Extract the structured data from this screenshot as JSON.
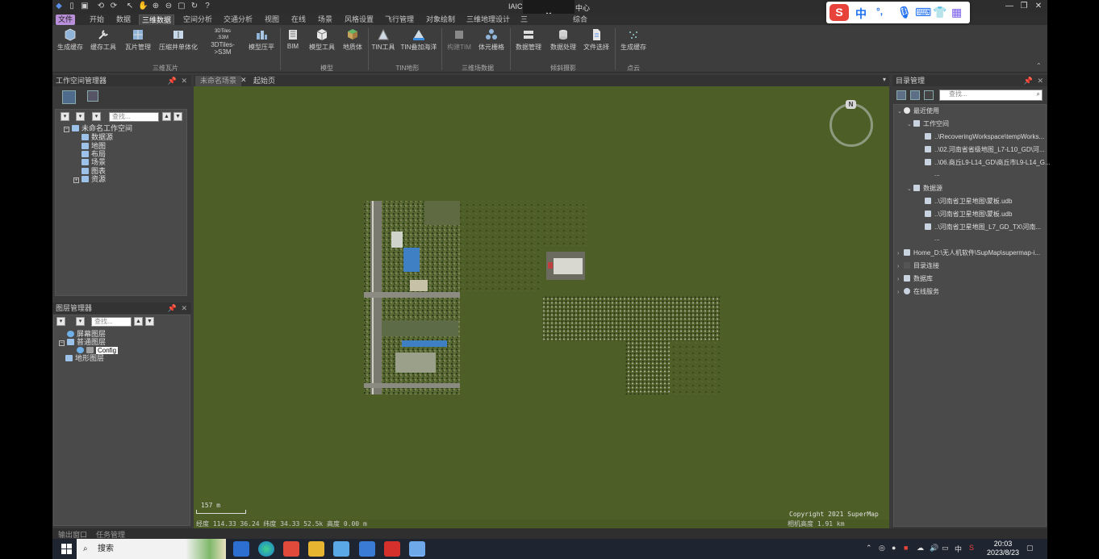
{
  "window": {
    "title_left": "IAIC",
    "title_right": "中心",
    "popup_glyph": "⌄"
  },
  "menus": [
    {
      "label": "文件",
      "cls": "file"
    },
    {
      "label": "开始"
    },
    {
      "label": "数据"
    },
    {
      "label": "三维数据",
      "cls": "active"
    },
    {
      "label": "空间分析"
    },
    {
      "label": "交通分析"
    },
    {
      "label": "视图"
    },
    {
      "label": "在线"
    },
    {
      "label": "场景"
    },
    {
      "label": "风格设置"
    },
    {
      "label": "飞行管理"
    },
    {
      "label": "对象绘制"
    },
    {
      "label": "三维地理设计"
    },
    {
      "label": "三"
    },
    {
      "label": "综合"
    }
  ],
  "ribbon": {
    "buttons": [
      "生成缓存",
      "缓存工具",
      "瓦片管理",
      "压缩并单体化",
      "3DTiles->S3M",
      "模型压平",
      "BIM",
      "模型工具",
      "地质体",
      "TIN工具",
      "TIN叠加海洋",
      "构建TIM",
      "体元栅格",
      "数据管理",
      "数据处理",
      "文件选择",
      "生成缓存"
    ],
    "groups": [
      "三维瓦片",
      "模型",
      "TIN地形",
      "三维场数据",
      "倾斜摄影",
      "点云"
    ],
    "icon_labels": {
      "tiles3d": "3DTiles",
      "s3m": ".S3M"
    }
  },
  "workspace_panel": {
    "title": "工作空间管理器",
    "search_placeholder": "查找...",
    "items": [
      "未命名工作空间",
      "数据源",
      "地图",
      "布局",
      "场景",
      "图表",
      "资源"
    ]
  },
  "layer_panel": {
    "title": "图层管理器",
    "search_placeholder": "查找...",
    "items": [
      "屏幕图层",
      "普通图层",
      "Config",
      "地形图层"
    ]
  },
  "doc_tabs": [
    "未命名场景",
    "起始页"
  ],
  "scene": {
    "compass_label": "N",
    "scale_text": "157 m",
    "copyright": "Copyright 2021 SuperMap",
    "status": "经度 114.33   36.24   纬度 34.33   52.5k  高度 0.00 m",
    "camera": "相机高度 1.91 km"
  },
  "catalog": {
    "title": "目录管理",
    "search_placeholder": "查找...",
    "items": [
      {
        "text": "最近使用"
      },
      {
        "text": "工作空间"
      },
      {
        "text": "..\\RecoveringWorkspace\\tempWorks..."
      },
      {
        "text": "..\\02.河南省省级地图_L7-L10_GD\\河..."
      },
      {
        "text": "..\\06.商丘L9-L14_GD\\商丘市L9-L14_G..."
      },
      {
        "text": "..."
      },
      {
        "text": "数据源"
      },
      {
        "text": "..\\河南省卫星地图\\蒙板.udb"
      },
      {
        "text": "..\\河南省卫星地图\\蒙板.udb"
      },
      {
        "text": "..\\河南省卫星地图_L7_GD_TX\\河南..."
      },
      {
        "text": "..."
      },
      {
        "text": "Home_D:\\无人机软件\\SupMap\\supermap-i..."
      },
      {
        "text": "目录连接"
      },
      {
        "text": "数据库"
      },
      {
        "text": "在线服务"
      }
    ]
  },
  "bottom_tabs": [
    "输出窗口",
    "任务管理"
  ],
  "ime": {
    "mode": "中",
    "punct": "°,"
  },
  "taskbar": {
    "search": "搜索",
    "tray_lang": "中",
    "time": "20:03",
    "date": "2023/8/23"
  },
  "colors": {
    "scene_bg": "#4d5f26",
    "accent": "#5a8fd8",
    "file_menu": "#b88fd8"
  }
}
